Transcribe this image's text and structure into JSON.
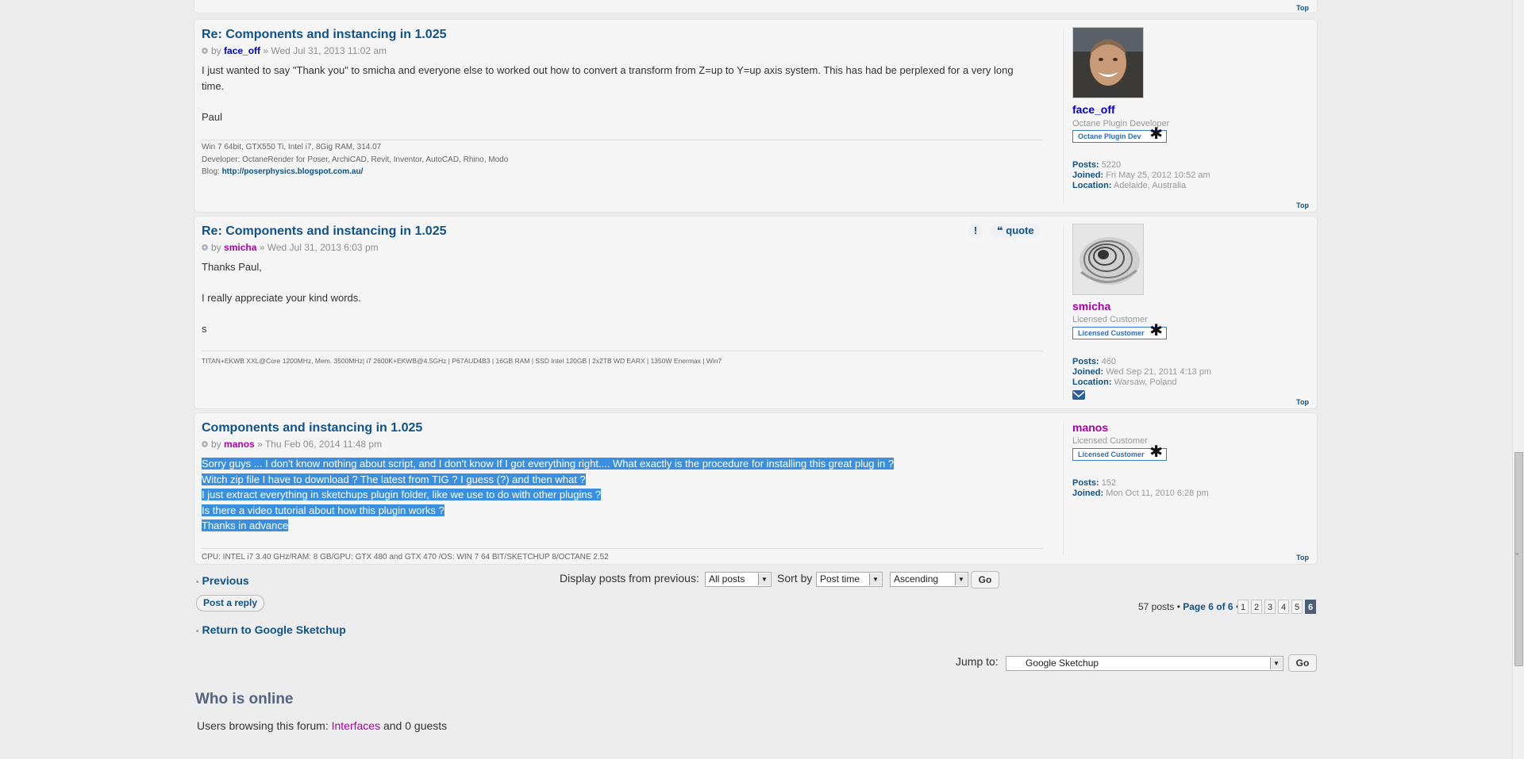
{
  "top_link": "Top",
  "posts": [
    {
      "title": "Re: Components and instancing in 1.025",
      "by": "by",
      "author": "face_off",
      "author_color": "#0000cc",
      "date": "» Wed Jul 31, 2013 11:02 am",
      "lines": [
        "I just wanted to say \"Thank you\" to smicha and everyone else to worked out how to convert a transform from Z=up to Y=up axis system. This has had be perplexed for a very long",
        "time.",
        "",
        "Paul"
      ],
      "sig": [
        "Win 7 64bit, GTX550 Ti, Intel i7, 8Gig RAM, 314.07",
        "Developer: OctaneRender for Poser, ArchiCAD, Revit, Inventor, AutoCAD, Rhino, Modo"
      ],
      "sig_blog_label": "Blog:",
      "sig_blog_link": "http://poserphysics.blogspot.com.au/",
      "profile": {
        "name": "face_off",
        "rank": "Octane Plugin Developer",
        "badge": "Octane Plugin Dev",
        "posts_label": "Posts:",
        "posts": "5220",
        "joined_label": "Joined:",
        "joined": "Fri May 25, 2012 10:52 am",
        "location_label": "Location:",
        "location": "Adelaide, Australia"
      }
    },
    {
      "title": "Re: Components and instancing in 1.025",
      "by": "by",
      "author": "smicha",
      "author_color": "#aa00aa",
      "date": "» Wed Jul 31, 2013 6:03 pm",
      "report_icon": "!",
      "quote_label": "quote",
      "lines": [
        "Thanks Paul,",
        "",
        "I really appreciate your kind words.",
        "",
        "s"
      ],
      "sig": [
        "TITAN+EKWB XXL@Core 1200MHz, Mem. 3500MHz| i7 2600K+EKWB@4.5GHz | P67AUD4B3 | 16GB RAM | SSD Intel 120GB | 2x2TB WD EARX | 1350W Enermax | Win7"
      ],
      "profile": {
        "name": "smicha",
        "rank": "Licensed Customer",
        "badge": "Licensed Customer",
        "posts_label": "Posts:",
        "posts": "460",
        "joined_label": "Joined:",
        "joined": "Wed Sep 21, 2011 4:13 pm",
        "location_label": "Location:",
        "location": "Warsaw, Poland"
      }
    },
    {
      "title": "Components and instancing in 1.025",
      "by": "by",
      "author": "manos",
      "author_color": "#aa00aa",
      "date": "» Thu Feb 06, 2014 11:48 pm",
      "lines": [
        "Sorry guys ... I don't know nothing about script, and I don't know If I got everything right.... What exactly is the procedure for installing this great plug in ?",
        "Witch zip file I have to download ? The latest from TIG ? I guess (?) and then what ?",
        "I just extract everything in sketchups plugin folder, like we use to do with other plugins ?",
        "Is there a video tutorial about how this plugin works ?",
        "Thanks in advance"
      ],
      "sig": [
        "CPU: INTEL i7 3.40 GHz/RAM: 8 GB/GPU: GTX 480 and GTX 470 /OS: WIN 7 64 BIT/SKETCHUP 8/OCTANE 2.52"
      ],
      "profile": {
        "name": "manos",
        "rank": "Licensed Customer",
        "badge": "Licensed Customer",
        "posts_label": "Posts:",
        "posts": "152",
        "joined_label": "Joined:",
        "joined": "Mon Oct 11, 2010 6:28 pm"
      }
    }
  ],
  "nav": {
    "previous": "Previous",
    "post_reply": "Post a reply",
    "return": "Return to Google Sketchup",
    "display_label": "Display posts from previous:",
    "display_value": "All posts",
    "sort_label": "Sort by",
    "sort_value": "Post time",
    "order_value": "Ascending",
    "go": "Go",
    "pagination_text": "57 posts •",
    "page_of": "Page 6 of 6",
    "bullet": "•",
    "pages": [
      "1",
      "2",
      "3",
      "4",
      "5",
      "6"
    ],
    "jump_label": "Jump to:",
    "jump_value": "Google Sketchup"
  },
  "online": {
    "heading": "Who is online",
    "text_prefix": "Users browsing this forum:",
    "user": "Interfaces",
    "text_suffix": "and 0 guests"
  },
  "colors": {
    "link": "#105289",
    "selection": "#3b8fe0",
    "user_purple": "#aa00aa"
  }
}
